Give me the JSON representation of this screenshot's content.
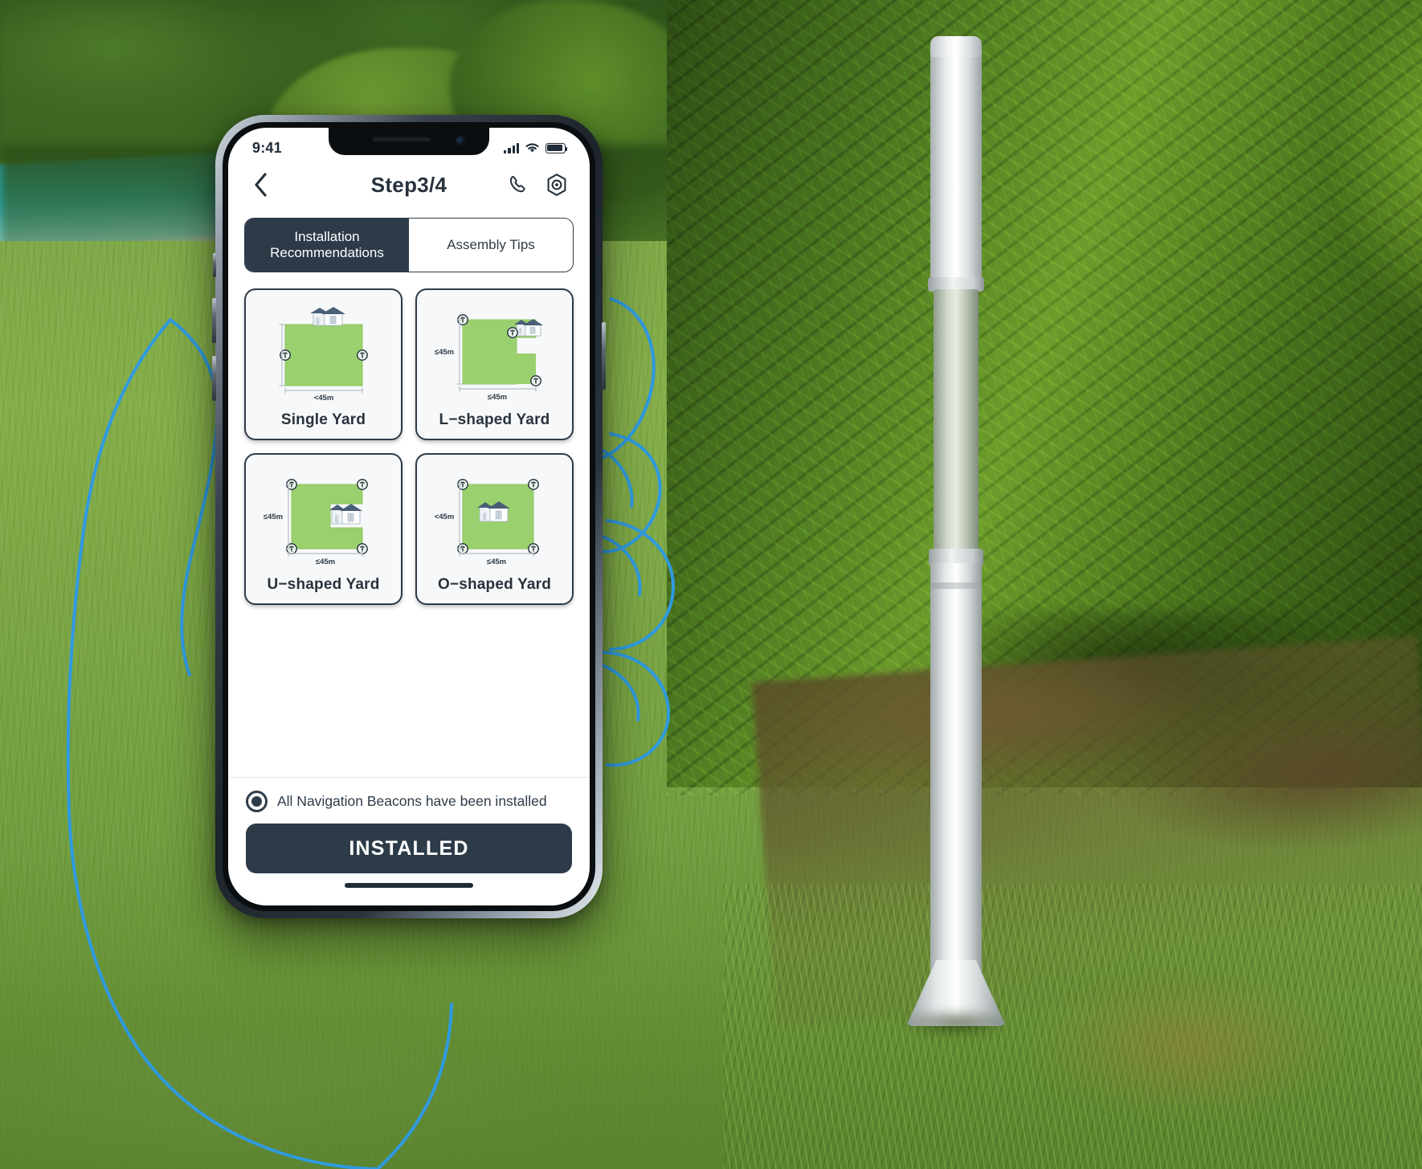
{
  "status_bar": {
    "time": "9:41",
    "signal_icon": "cellular-signal-icon",
    "wifi_icon": "wifi-icon",
    "battery_icon": "battery-full-icon"
  },
  "nav": {
    "back_icon": "chevron-left-icon",
    "title": "Step3/4",
    "actions": [
      {
        "name": "support-call-icon",
        "icon": "phone-handset-icon"
      },
      {
        "name": "settings-icon",
        "icon": "hex-gear-icon"
      }
    ]
  },
  "tabs": [
    {
      "id": "installation-recommendations",
      "label": "Installation Recommendations",
      "active": true
    },
    {
      "id": "assembly-tips",
      "label": "Assembly Tips",
      "active": false
    }
  ],
  "yard_cards": [
    {
      "id": "single-yard",
      "label": "Single Yard",
      "shape": "single",
      "width_label": "<45m",
      "height_label": "",
      "beacons": 2,
      "house": "top-center"
    },
    {
      "id": "l-shaped-yard",
      "label": "L−shaped Yard",
      "shape": "l",
      "width_label": "≤45m",
      "height_label": "≤45m",
      "beacons": 3,
      "house": "top-right"
    },
    {
      "id": "u-shaped-yard",
      "label": "U−shaped Yard",
      "shape": "u",
      "width_label": "≤45m",
      "height_label": "≤45m",
      "beacons": 4,
      "house": "right-middle"
    },
    {
      "id": "o-shaped-yard",
      "label": "O−shaped Yard",
      "shape": "o",
      "width_label": "≤45m",
      "height_label": "<45m",
      "beacons": 4,
      "house": "center"
    }
  ],
  "bottom": {
    "confirm_label": "All Navigation Beacons have been installed",
    "confirm_checked": true,
    "primary_button": "INSTALLED"
  },
  "colors": {
    "ink": "#2d3b49",
    "lawn_green": "#9ad06e",
    "card_bg": "#f7f8f9",
    "accent_line": "#4aa3e0"
  },
  "scene": {
    "device": "smartphone",
    "background": "garden lawn with hedge and white bollard lamp",
    "hand_outline": "blue line-art hand holding phone"
  }
}
